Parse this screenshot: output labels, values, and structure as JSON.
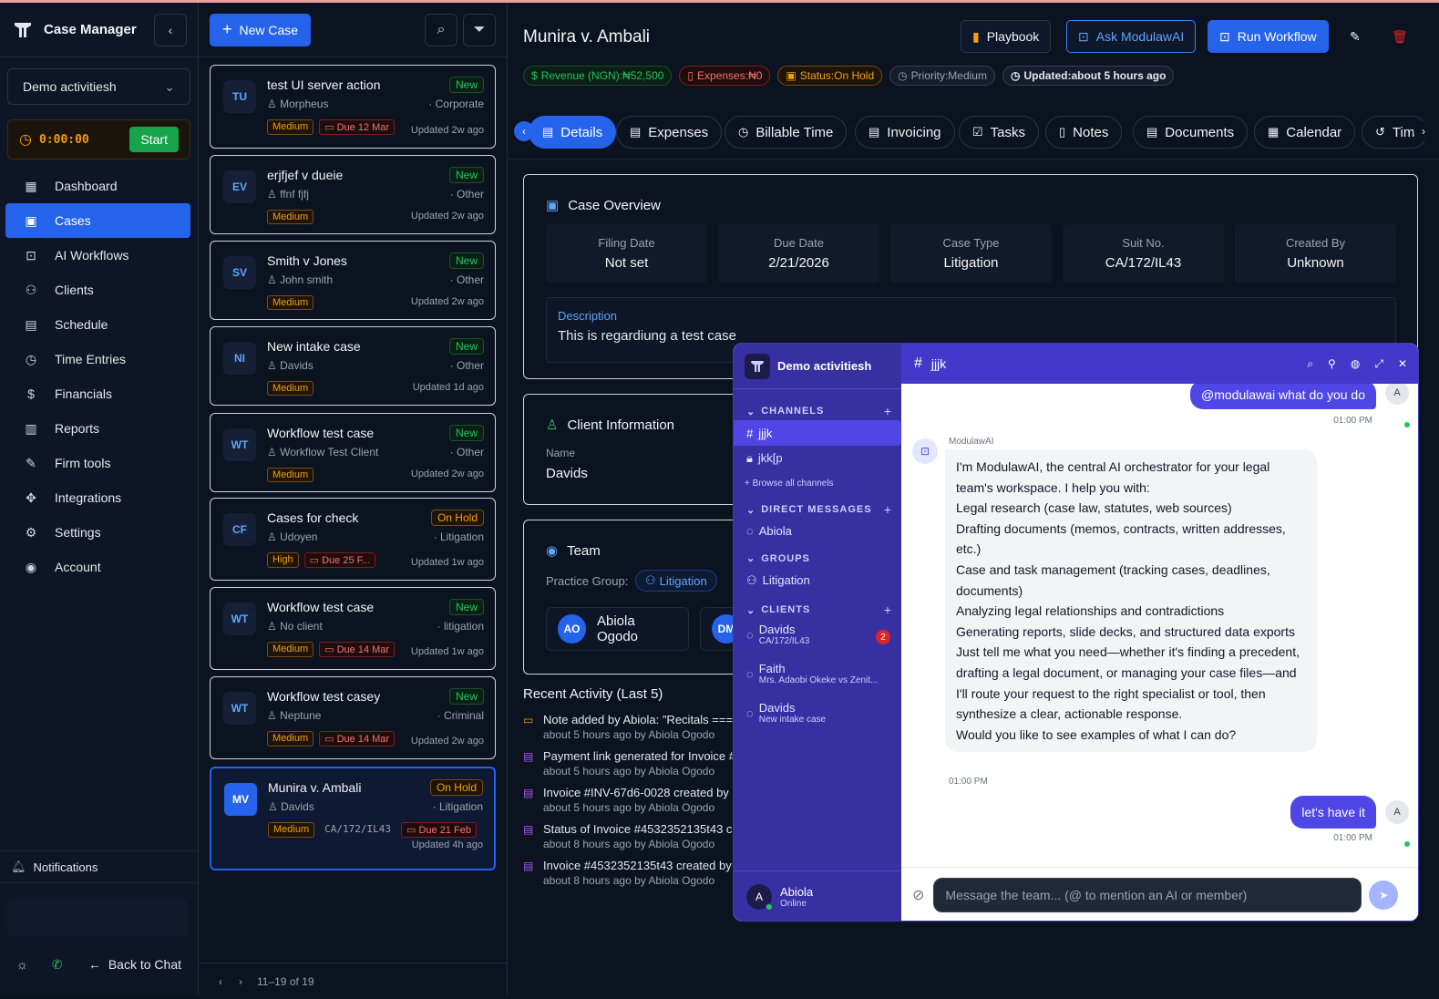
{
  "app": {
    "title": "Case Manager"
  },
  "sidebar": {
    "workspace": "Demo activitiesh",
    "timer": {
      "value": "0:00:00",
      "start_label": "Start"
    },
    "items": [
      {
        "label": "Dashboard",
        "icon": "dashboard-icon"
      },
      {
        "label": "Cases",
        "icon": "briefcase-icon",
        "active": true
      },
      {
        "label": "AI Workflows",
        "icon": "robot-icon"
      },
      {
        "label": "Clients",
        "icon": "users-icon"
      },
      {
        "label": "Schedule",
        "icon": "calendar-icon"
      },
      {
        "label": "Time Entries",
        "icon": "clock-icon"
      },
      {
        "label": "Financials",
        "icon": "dollar-icon"
      },
      {
        "label": "Reports",
        "icon": "bar-chart-icon"
      },
      {
        "label": "Firm tools",
        "icon": "wrench-icon"
      },
      {
        "label": "Integrations",
        "icon": "puzzle-icon"
      },
      {
        "label": "Settings",
        "icon": "gear-icon"
      },
      {
        "label": "Account",
        "icon": "user-circle-icon"
      }
    ],
    "notifications_label": "Notifications",
    "back_label": "Back to Chat"
  },
  "case_list": {
    "new_case_label": "New Case",
    "cards": [
      {
        "initials": "TU",
        "title": "test UI server action",
        "client": "Morpheus",
        "status": "New",
        "type": "· Corporate",
        "priority": "Medium",
        "due": "Due 12 Mar",
        "suit": "",
        "updated": "Updated 2w ago"
      },
      {
        "initials": "EV",
        "title": "erjfjef v dueie",
        "client": "ffnf fjfj",
        "status": "New",
        "type": "· Other",
        "priority": "Medium",
        "due": "",
        "suit": "",
        "updated": "Updated 2w ago"
      },
      {
        "initials": "SV",
        "title": "Smith v Jones",
        "client": "John smith",
        "status": "New",
        "type": "· Other",
        "priority": "Medium",
        "due": "",
        "suit": "",
        "updated": "Updated 2w ago"
      },
      {
        "initials": "NI",
        "title": "New intake case",
        "client": "Davids",
        "status": "New",
        "type": "· Other",
        "priority": "Medium",
        "due": "",
        "suit": "",
        "updated": "Updated 1d ago"
      },
      {
        "initials": "WT",
        "title": "Workflow test case",
        "client": "Workflow Test Client",
        "status": "New",
        "type": "· Other",
        "priority": "Medium",
        "due": "",
        "suit": "",
        "updated": "Updated 2w ago"
      },
      {
        "initials": "CF",
        "title": "Cases for check",
        "client": "Udoyen",
        "status": "On Hold",
        "type": "· Litigation",
        "priority": "High",
        "due": "Due 25 F...",
        "suit": "",
        "updated": "Updated 1w ago"
      },
      {
        "initials": "WT",
        "title": "Workflow test case",
        "client": "No client",
        "status": "New",
        "type": "· litigation",
        "priority": "Medium",
        "due": "Due 14 Mar",
        "suit": "",
        "updated": "Updated 1w ago"
      },
      {
        "initials": "WT",
        "title": "Workflow test casey",
        "client": "Neptune",
        "status": "New",
        "type": "· Criminal",
        "priority": "Medium",
        "due": "Due 14 Mar",
        "suit": "",
        "updated": "Updated 2w ago"
      },
      {
        "initials": "MV",
        "title": "Munira v. Ambali",
        "client": "Davids",
        "status": "On Hold",
        "type": "· Litigation",
        "priority": "Medium",
        "due": "Due 21 Feb",
        "suit": "CA/172/IL43",
        "updated": "Updated 4h ago",
        "selected": true
      }
    ],
    "pager": "11–19 of 19"
  },
  "case": {
    "title": "Munira v. Ambali",
    "buttons": {
      "playbook": "Playbook",
      "ask": "Ask ModulawAI",
      "run": "Run Workflow"
    },
    "badges": {
      "revenue": "Revenue (NGN):₦52,500",
      "expenses": "Expenses:₦0",
      "status": "Status:On Hold",
      "priority": "Priority:Medium",
      "updated": "Updated:about 5 hours ago"
    },
    "tabs": [
      "Details",
      "Expenses",
      "Billable Time",
      "Invoicing",
      "Tasks",
      "Notes",
      "Documents",
      "Calendar",
      "Tim"
    ],
    "overview": {
      "title": "Case Overview",
      "fields": [
        {
          "k": "Filing Date",
          "v": "Not set"
        },
        {
          "k": "Due Date",
          "v": "2/21/2026"
        },
        {
          "k": "Case Type",
          "v": "Litigation"
        },
        {
          "k": "Suit No.",
          "v": "CA/172/IL43"
        },
        {
          "k": "Created By",
          "v": "Unknown"
        }
      ],
      "desc_label": "Description",
      "desc": "This is regardiung a test case"
    },
    "client": {
      "title": "Client Information",
      "name_label": "Name",
      "name": "Davids"
    },
    "team": {
      "title": "Team",
      "pg_label": "Practice Group:",
      "pg": "Litigation",
      "member_initials": "AO",
      "member_name": "Abiola Ogodo",
      "member2_initials": "DM"
    },
    "activity": {
      "title": "Recent Activity (Last 5)",
      "items": [
        {
          "t": "Note added by Abiola: \"Recitals ====",
          "s": "about 5 hours ago by Abiola Ogodo"
        },
        {
          "t": "Payment link generated for Invoice #I",
          "s": "about 5 hours ago by Abiola Ogodo"
        },
        {
          "t": "Invoice #INV-67d6-0028 created by",
          "s": "about 5 hours ago by Abiola Ogodo"
        },
        {
          "t": "Status of Invoice #4532352135t43 c",
          "s": "about 8 hours ago by Abiola Ogodo"
        },
        {
          "t": "Invoice #4532352135t43 created by",
          "s": "about 8 hours ago by Abiola Ogodo"
        }
      ]
    }
  },
  "chat": {
    "workspace": "Demo activitiesh",
    "channel": "jjjk",
    "sections": {
      "channels": "CHANNELS",
      "dms": "DIRECT MESSAGES",
      "groups": "GROUPS",
      "clients": "CLIENTS"
    },
    "channels": [
      "jjjk",
      "jkk[p"
    ],
    "browse": "+ Browse all channels",
    "dms": [
      "Abiola"
    ],
    "groups": [
      "Litigation"
    ],
    "clients": [
      {
        "name": "Davids",
        "sub": "CA/172/IL43",
        "unread": "2"
      },
      {
        "name": "Faith",
        "sub": "Mrs. Adaobi Okeke vs Zenit..."
      },
      {
        "name": "Davids",
        "sub": "New intake case"
      }
    ],
    "user": {
      "initial": "A",
      "name": "Abiola",
      "status": "Online"
    },
    "messages": {
      "m1": "@modulawai what do you do",
      "m1_time": "01:00 PM",
      "bot_name": "ModulawAI",
      "bot_text": "I'm ModulawAI, the central AI orchestrator for your legal team's workspace. I help you with:\nLegal research (case law, statutes, web sources)\nDrafting documents (memos, contracts, written addresses, etc.)\nCase and task management (tracking cases, deadlines, documents)\nAnalyzing legal relationships and contradictions\nGenerating reports, slide decks, and structured data exports\nJust tell me what you need—whether it's finding a precedent, drafting a legal document, or managing your case files—and I'll route your request to the right specialist or tool, then synthesize a clear, actionable response.\nWould you like to see examples of what I can do?",
      "bot_time": "01:00 PM",
      "m2": "let's have it",
      "m2_time": "01:00 PM",
      "me_initial": "A"
    },
    "input_placeholder": "Message the team... (@ to mention an AI or member)"
  }
}
